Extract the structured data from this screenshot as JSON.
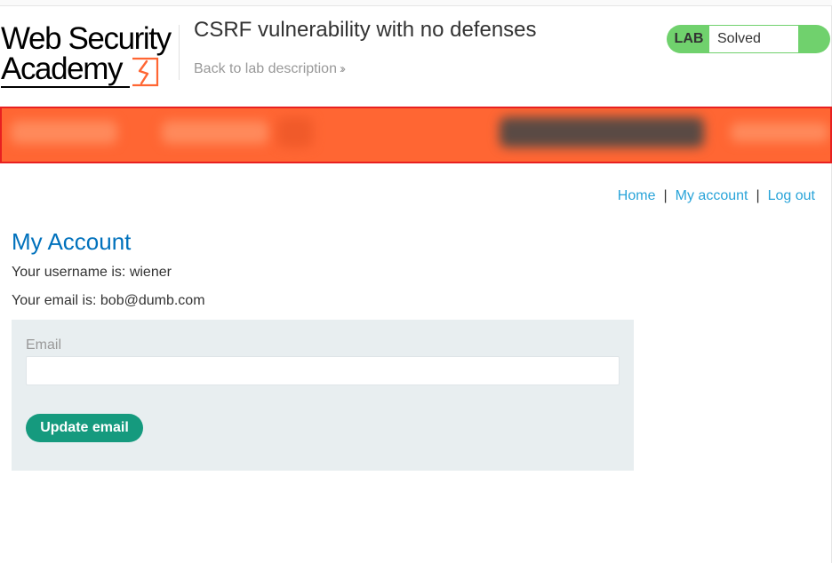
{
  "header": {
    "logo": {
      "line1": "Web Security",
      "line2": "Academy",
      "icon": "flash-icon"
    },
    "lab_title": "CSRF vulnerability with no defenses",
    "back_link": "Back to lab description",
    "back_icon": "double-chevron-right-icon",
    "status": {
      "tag": "LAB",
      "state": "Solved",
      "color": "#70d16d"
    }
  },
  "banner": {
    "color": "#ff6633",
    "border_color": "#e82020"
  },
  "nav": {
    "home": "Home",
    "separator": "|",
    "my_account": "My account",
    "log_out": "Log out"
  },
  "main": {
    "heading": "My Account",
    "username_line": "Your username is: wiener",
    "email_line": "Your email is: bob@dumb.com",
    "form": {
      "email_label": "Email",
      "email_value": "",
      "submit_label": "Update email"
    }
  },
  "colors": {
    "link": "#29a4d9",
    "heading": "#0071bc",
    "button": "#159a7e",
    "panel": "#e8eef0"
  }
}
